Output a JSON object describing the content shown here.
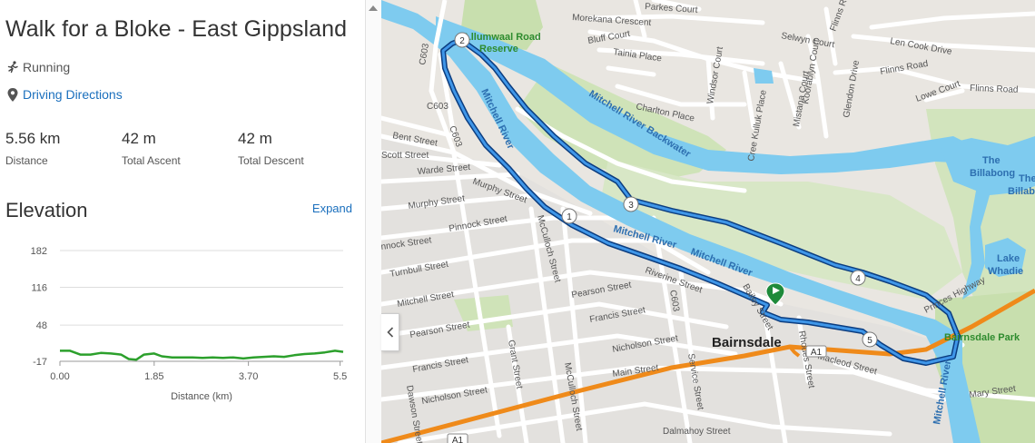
{
  "route": {
    "title": "Walk for a Bloke - East Gippsland",
    "activity": "Running",
    "directions_label": "Driving Directions"
  },
  "stats": [
    {
      "value": "5.56 km",
      "label": "Distance"
    },
    {
      "value": "42 m",
      "label": "Total Ascent"
    },
    {
      "value": "42 m",
      "label": "Total Descent"
    }
  ],
  "elevation": {
    "title": "Elevation",
    "expand_label": "Expand"
  },
  "chart_data": {
    "type": "line",
    "title": "",
    "xlabel": "Distance (km)",
    "ylabel": "",
    "x_ticks": [
      "0.00",
      "1.85",
      "3.70",
      "5.5"
    ],
    "y_ticks": [
      "182",
      "116",
      "48",
      "-17"
    ],
    "xlim": [
      0,
      5.56
    ],
    "ylim": [
      -17,
      182
    ],
    "grid": true,
    "series": [
      {
        "color": "#2ca02c",
        "x": [
          0,
          0.2,
          0.4,
          0.6,
          0.8,
          1.0,
          1.2,
          1.35,
          1.5,
          1.65,
          1.85,
          2.0,
          2.2,
          2.4,
          2.6,
          2.8,
          3.0,
          3.2,
          3.4,
          3.6,
          3.8,
          4.0,
          4.2,
          4.4,
          4.6,
          4.8,
          5.0,
          5.2,
          5.4,
          5.56
        ],
        "y": [
          2,
          2,
          -5,
          -5,
          -2,
          -3,
          -5,
          -13,
          -14,
          -5,
          -3,
          -8,
          -10,
          -10,
          -10,
          -11,
          -10,
          -11,
          -10,
          -12,
          -10,
          -9,
          -8,
          -9,
          -6,
          -4,
          -3,
          -1,
          2,
          0
        ]
      }
    ]
  },
  "map": {
    "colors": {
      "land": "#e9e6e1",
      "park": "#c8dfae",
      "water": "#7ecbef",
      "road": "#ffffff",
      "highway": "#ef8a1a",
      "route": "#1f6ec2"
    },
    "collapse_icon": "chevron-left-icon",
    "start_marker_icon": "flag-icon",
    "waypoints": [
      "1",
      "2",
      "3",
      "4",
      "5"
    ],
    "labels": {
      "bairnsdale": "Bairnsdale",
      "bairnsdale_park": "Bairnsdale Park",
      "lake_whadie_1": "Lake",
      "lake_whadie_2": "Whadie",
      "billabong_1": "The",
      "billabong_2": "Billabong",
      "billabong_b1": "The",
      "billabong_b2": "Billabo",
      "river_1": "Mitchell River",
      "river_2": "Mitchell River",
      "river_3": "Mitchell River",
      "river_4": "Mitchell River",
      "river_5": "Mitchell River",
      "backwater": "Mitchell River Backwater",
      "reserve_1": "Lllumwaal Road",
      "reserve_2": "Reserve",
      "a1_1": "A1",
      "a1_2": "A1",
      "c603_1": "C603",
      "c603_2": "C603",
      "c603_3": "C603",
      "c603_4": "C603",
      "morekana": "Morekana Crescent",
      "parkes": "Parkes Court",
      "flinns_1": "Flinns Road",
      "flinns_2": "Flinns Road",
      "flinns_3": "Flinns Road",
      "selwyn": "Selwyn Court",
      "len_cook": "Len Cook Drive",
      "bluff": "Bluff Court",
      "tainia": "Tainia Place",
      "windsor": "Windsor Court",
      "koorablyn": "Koorablyn Court",
      "glendon": "Glendon Drive",
      "lowe": "Lowe Court",
      "charlton": "Charlton Place",
      "kulluk": "Cree Kulluk Place",
      "mistana": "Mistana Court",
      "bent": "Bent Street",
      "scott": "Scott Street",
      "warde": "Warde Street",
      "murphy_1": "Murphy Street",
      "murphy_2": "Murphy Street",
      "pinnock_1": "Pinnock Street",
      "pinnock_2": "nnock Street",
      "mcculloch_1": "McCulloch Street",
      "mcculloch_2": "McCulloch Street",
      "turnbull": "Turnbull Street",
      "mitchell_st": "Mitchell Street",
      "pearson_1": "Pearson Street",
      "pearson_2": "Pearson Street",
      "riveroo": "Riverine Street",
      "francis_1": "Francis Street",
      "francis_2": "Francis Street",
      "nicholson_1": "Nicholson Street",
      "nicholson_2": "Nicholson Street",
      "grant": "Grant Street",
      "dawson": "Dawson Street",
      "main": "Main Street",
      "service": "Service Street",
      "macleod": "Macleod Street",
      "mary": "Mary Street",
      "dalmahoy": "Dalmahoy Street",
      "princes": "Princes Highway",
      "bailey": "Bailey Street",
      "rhodes": "Rhodes Street"
    }
  }
}
